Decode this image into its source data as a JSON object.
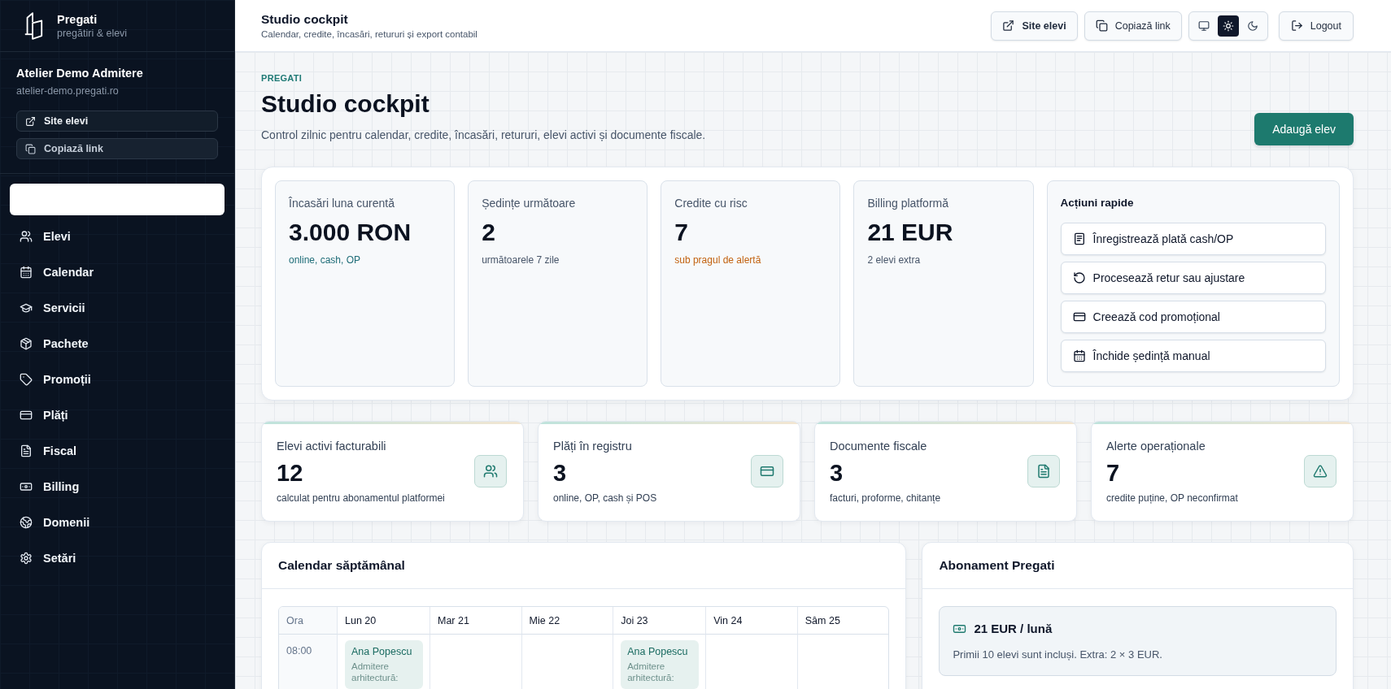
{
  "sidebar": {
    "brand": {
      "name": "Pregati",
      "tagline": "pregătiri & elevi"
    },
    "tenant": {
      "name": "Atelier Demo Admitere",
      "domain": "atelier-demo.pregati.ro",
      "buttons": [
        "Site elevi",
        "Copiază link"
      ]
    },
    "blank_panel": true,
    "nav": [
      "Elevi",
      "Calendar",
      "Servicii",
      "Pachete",
      "Promoții",
      "Plăți",
      "Fiscal",
      "Billing",
      "Domenii",
      "Setări"
    ]
  },
  "header": {
    "title": "Studio cockpit",
    "subtitle": "Calendar, credite, încasări, retururi și export contabil",
    "buttons": [
      "Site elevi",
      "Copiază link"
    ],
    "theme_options": [
      {
        "selected": false
      },
      {
        "selected": true
      },
      {
        "selected": false
      }
    ],
    "logout": "Logout"
  },
  "page": {
    "eyebrow": "PREGATI",
    "title": "Studio cockpit",
    "description": "Control zilnic pentru calendar, credite, încasări, retururi, elevi activi și documente fiscale.",
    "primary_button": "Adaugă elev"
  },
  "overview": {
    "stats": [
      {
        "label": "Încasări luna curentă",
        "value": "3.000 RON",
        "note": "online, cash, OP",
        "color": "#1f6d78"
      },
      {
        "label": "Ședințe următoare",
        "value": "2",
        "note": "următoarele 7 zile",
        "color": "#475569"
      },
      {
        "label": "Credite cu risc",
        "value": "7",
        "note": "sub pragul de alertă",
        "color": "#c2620f"
      },
      {
        "label": "Billing platformă",
        "value": "21 EUR",
        "note": "2 elevi extra",
        "color": "#475569"
      }
    ],
    "quick_actions": {
      "title": "Acțiuni rapide",
      "buttons": [
        "Înregistrează plată cash/OP",
        "Procesează retur sau ajustare",
        "Creează cod promoțional",
        "Închide ședință manual"
      ]
    }
  },
  "kpis": [
    {
      "label": "Elevi activi facturabili",
      "value": "12",
      "note": "calculat pentru abonamentul platformei"
    },
    {
      "label": "Plăți în registru",
      "value": "3",
      "note": "online, OP, cash și POS"
    },
    {
      "label": "Documente fiscale",
      "value": "3",
      "note": "facturi, proforme, chitanțe"
    },
    {
      "label": "Alerte operaționale",
      "value": "7",
      "note": "credite puține, OP neconfirmat"
    }
  ],
  "calendar": {
    "title": "Calendar săptămânal",
    "columns": [
      "Ora",
      "Lun 20",
      "Mar 21",
      "Mie 22",
      "Joi 23",
      "Vin 24",
      "Sâm 25"
    ],
    "rows": [
      {
        "cells": [
          "08:00",
          {
            "name": "Ana Popescu",
            "detail": "Admitere arhitectură:"
          },
          "",
          "",
          {
            "name": "Ana Popescu",
            "detail": "Admitere arhitectură:"
          },
          "",
          ""
        ]
      }
    ]
  },
  "subscription": {
    "title": "Abonament Pregati",
    "plan": "21 EUR / lună",
    "note": "Primii 10 elevi sunt incluși. Extra: 2 × 3 EUR."
  }
}
